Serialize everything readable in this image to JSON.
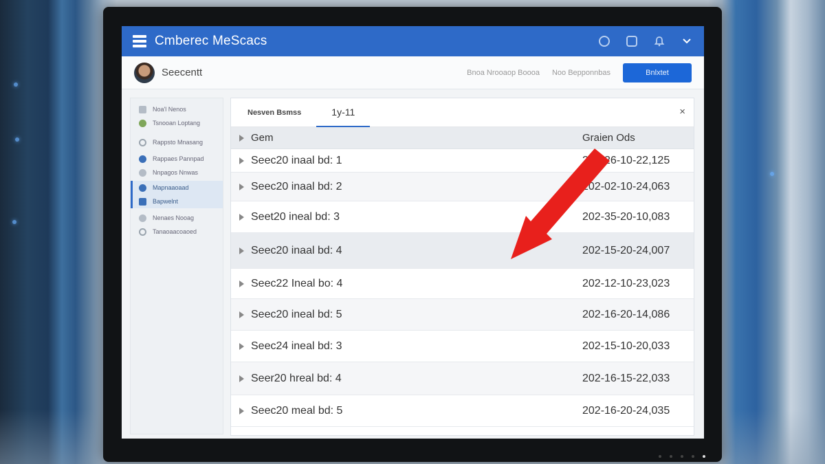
{
  "app": {
    "title": "Cmberec MeScacs",
    "accent": "#2e6ac8"
  },
  "titlebar_icons": [
    "circle-icon",
    "square-icon",
    "bell-icon",
    "chevron-down-icon"
  ],
  "header": {
    "user_name": "Seecentt",
    "links": [
      "Bnoa Nrooaop Boooa",
      "Noo Bepponnbas"
    ],
    "button_label": "Bnlxtet"
  },
  "sidebar": {
    "items": [
      {
        "label": "Noa'l Nenos",
        "icon": "square-icon"
      },
      {
        "label": "Tsnooan Loptang",
        "icon": "avatar-icon"
      },
      {
        "label": "Rappsto Mnasang",
        "icon": "ring-icon"
      },
      {
        "label": "Rappaes Pannpad",
        "icon": "person-icon"
      },
      {
        "label": "Nnpagos Nnwas",
        "icon": "circle-icon"
      },
      {
        "label": "Mapnaaoaad",
        "icon": "dot-icon",
        "active": true
      },
      {
        "label": "Bapwelnt",
        "icon": "square-icon"
      },
      {
        "label": "Nenaes Nooag",
        "icon": "circle-icon"
      },
      {
        "label": "Tanaoaacoaoed",
        "icon": "ring-icon"
      }
    ]
  },
  "panel": {
    "tabs": [
      {
        "label": "Nesven Bsmss",
        "active": false
      },
      {
        "label": "1y-11",
        "active": true
      }
    ],
    "close_label": "×",
    "columns": {
      "name": "Gem",
      "date": "Graien Ods"
    },
    "rows": [
      {
        "name": "Seec20 inaal bd: 1",
        "date": "202-26-10-22,125"
      },
      {
        "name": "Seec20 inaal bd: 2",
        "date": "202-02-10-24,063"
      },
      {
        "name": "Seet20 ineal bd: 3",
        "date": "202-35-20-10,083"
      },
      {
        "name": "Seec20 inaal bd: 4",
        "date": "202-15-20-24,007"
      },
      {
        "name": "Seec22 Ineal bo: 4",
        "date": "202-12-10-23,023"
      },
      {
        "name": "Seec20 ineal bd: 5",
        "date": "202-16-20-14,086"
      },
      {
        "name": "Seec24 ineal bd: 3",
        "date": "202-15-10-20,033"
      },
      {
        "name": "Seer20 hreal bd: 4",
        "date": "202-16-15-22,033"
      },
      {
        "name": "Seec20 meal bd: 5",
        "date": "202-16-20-24,035"
      }
    ]
  },
  "annotation": {
    "type": "arrow",
    "color": "#e8201c"
  }
}
